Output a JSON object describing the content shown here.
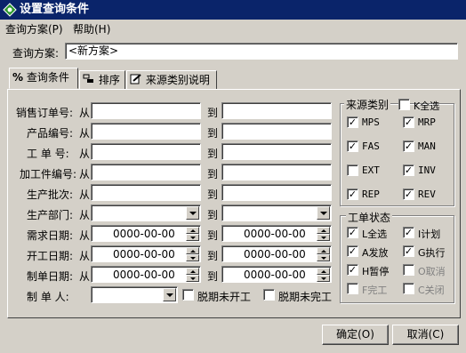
{
  "window": {
    "title": "设置查询条件",
    "icon": "app-icon"
  },
  "menu": [
    "查询方案(P)",
    "帮助(H)"
  ],
  "scheme": {
    "label": "查询方案:",
    "value": "<新方案>"
  },
  "tabs": [
    "查询条件",
    "排序",
    "来源类别说明"
  ],
  "fields": {
    "order_no": "销售订单号:",
    "product_no": "产品编号:",
    "work_no": "工 单 号:",
    "part_no": "加工件编号:",
    "batch": "生产批次:",
    "dept": "生产部门:",
    "demand_date": "需求日期:",
    "start_date": "开工日期:",
    "create_date": "制单日期:",
    "creator": "制 单 人:",
    "from": "从",
    "to": "到",
    "date_placeholder": "0000-00-00"
  },
  "options": {
    "not_started": "脱期未开工",
    "not_finished": "脱期未完工"
  },
  "source": {
    "title": "来源类别",
    "select_all": "K全选",
    "items": [
      "MPS",
      "MRP",
      "FAS",
      "MAN",
      "EXT",
      "INV",
      "REP",
      "REV"
    ],
    "checked": [
      true,
      true,
      true,
      true,
      false,
      true,
      true,
      true
    ]
  },
  "status": {
    "title": "工单状态",
    "items": [
      "L全选",
      "I计划",
      "A发放",
      "G执行",
      "H暂停",
      "O取消",
      "F完工",
      "C关闭"
    ],
    "checked": [
      true,
      true,
      true,
      true,
      true,
      false,
      false,
      false
    ],
    "disabled": [
      false,
      false,
      false,
      false,
      false,
      true,
      true,
      true
    ]
  },
  "buttons": {
    "ok": "确定(O)",
    "cancel": "取消(C)"
  }
}
